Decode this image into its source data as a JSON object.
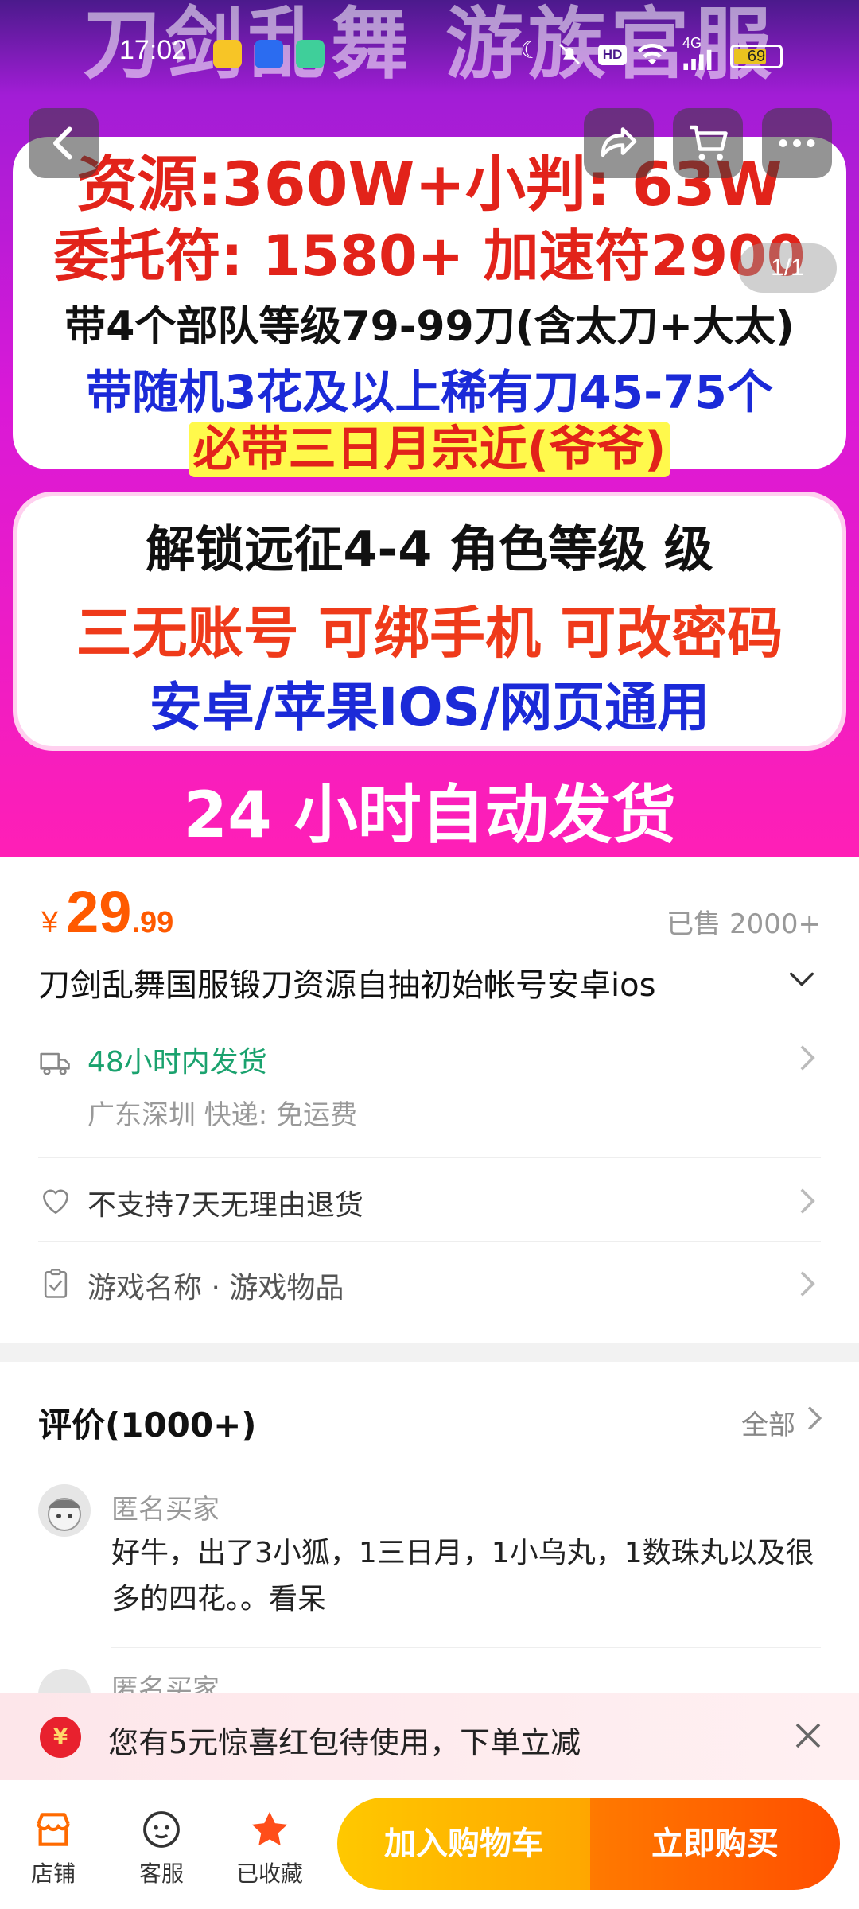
{
  "status_bar": {
    "time": "17:02",
    "network": "4G",
    "hd": "HD",
    "battery": "69"
  },
  "banner": {
    "bg_title": "刀剑乱舞 游族官服",
    "counter": "1/1",
    "lines": [
      "资源:360W+小判: 63W",
      "委托符: 1580+  加速符2900",
      "带4个部队等级79-99刀(含太刀+大太)",
      "带随机3花及以上稀有刀45-75个",
      "必带三日月宗近(爷爷)",
      "解锁远征4-4 角色等级   级",
      "三无账号 可绑手机 可改密码",
      "安卓/苹果IOS/网页通用",
      "24 小时自动发货"
    ],
    "colors": {
      "gradient_top": "#4b1a8c",
      "gradient_bottom": "#ff1fb6",
      "accent_red": "#e2231a",
      "accent_blue": "#1b2ad8"
    }
  },
  "product": {
    "currency": "¥",
    "price_int": "29",
    "price_dec": ".99",
    "sold": "已售 2000+",
    "title": "刀剑乱舞国服锻刀资源自抽初始帐号安卓ios",
    "price_color": "#ff5a00"
  },
  "shipping": {
    "promise": "48小时内发货",
    "origin": "广东深圳  快递: 免运费"
  },
  "returns": {
    "text": "不支持7天无理由退货"
  },
  "params": {
    "text": "游戏名称 · 游戏物品"
  },
  "reviews": {
    "title": "评价(1000+)",
    "all": "全部",
    "items": [
      {
        "user": "匿名买家",
        "text": "好牛，出了3小狐，1三日月，1小乌丸，1数珠丸以及很多的四花。。看呆"
      },
      {
        "user": "匿名买家"
      }
    ]
  },
  "promo": {
    "icon": "¥",
    "text": "您有5元惊喜红包待使用，下单立减"
  },
  "bottom_bar": {
    "shop": "店铺",
    "service": "客服",
    "favorite": "已收藏",
    "add_cart": "加入购物车",
    "buy_now": "立即购买"
  }
}
